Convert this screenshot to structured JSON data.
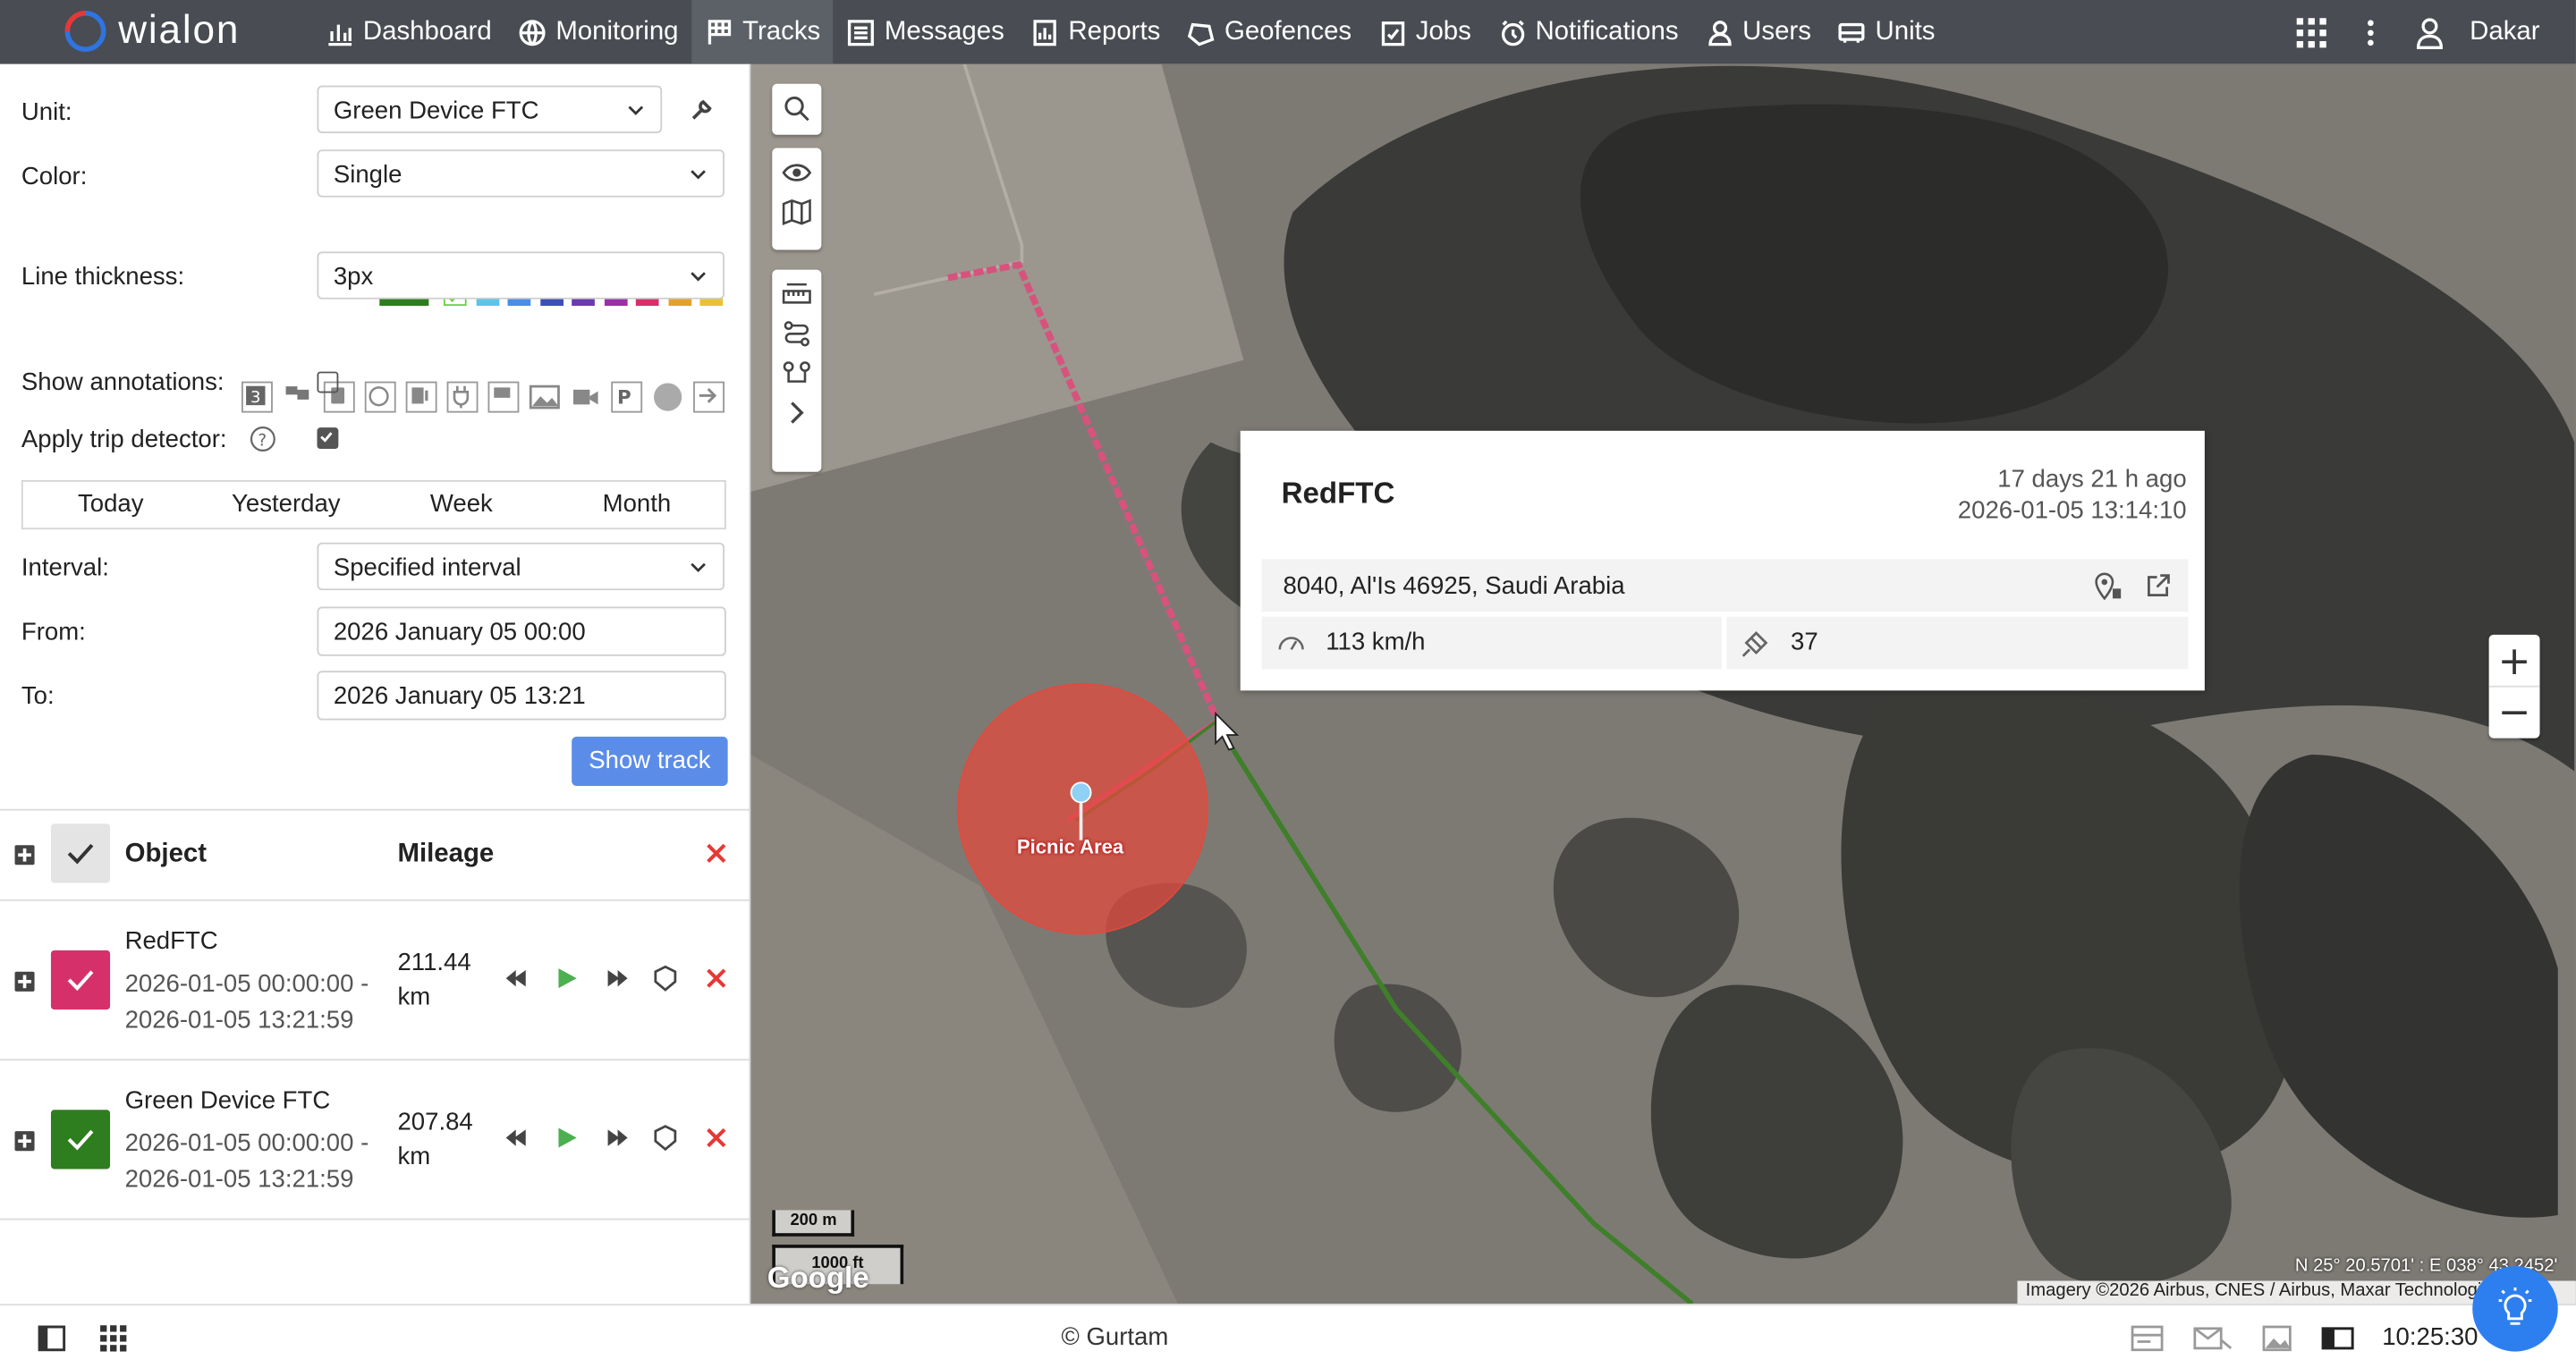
{
  "app": {
    "logo_text": "wialon",
    "user": "Dakar"
  },
  "nav": [
    {
      "label": "Dashboard",
      "icon": "bar-chart-icon"
    },
    {
      "label": "Monitoring",
      "icon": "globe-icon"
    },
    {
      "label": "Tracks",
      "icon": "flag-icon",
      "active": true
    },
    {
      "label": "Messages",
      "icon": "messages-icon"
    },
    {
      "label": "Reports",
      "icon": "reports-icon"
    },
    {
      "label": "Geofences",
      "icon": "geofence-icon"
    },
    {
      "label": "Jobs",
      "icon": "jobs-icon"
    },
    {
      "label": "Notifications",
      "icon": "alarm-icon"
    },
    {
      "label": "Users",
      "icon": "user-icon"
    },
    {
      "label": "Units",
      "icon": "car-icon"
    }
  ],
  "form": {
    "unit_label": "Unit:",
    "unit_value": "Green Device FTC",
    "color_label": "Color:",
    "color_value": "Single",
    "swatches": [
      "#2e7d1e",
      "#6ccf4a",
      "#5bc4e8",
      "#4a8ee8",
      "#3d4fb8",
      "#6a3ab0",
      "#9b2fa8",
      "#d62f6a",
      "#e4a12a",
      "#e8c234"
    ],
    "thickness_label": "Line thickness:",
    "thickness_value": "3px",
    "annotations_label": "Show annotations:",
    "trip_label": "Apply trip detector:",
    "tabs": [
      "Today",
      "Yesterday",
      "Week",
      "Month"
    ],
    "interval_label": "Interval:",
    "interval_value": "Specified interval",
    "from_label": "From:",
    "from_value": "2026 January 05 00:00",
    "to_label": "To:",
    "to_value": "2026 January 05 13:21",
    "show_track": "Show track"
  },
  "table": {
    "header_object": "Object",
    "header_mileage": "Mileage",
    "rows": [
      {
        "name": "RedFTC",
        "from": "2026-01-05 00:00:00 -",
        "to": "2026-01-05 13:21:59",
        "mileage": "211.44",
        "unit": "km",
        "color": "#d6306a"
      },
      {
        "name": "Green Device FTC",
        "from": "2026-01-05 00:00:00 -",
        "to": "2026-01-05 13:21:59",
        "mileage": "207.84",
        "unit": "km",
        "color": "#2e7d1e"
      }
    ]
  },
  "popup": {
    "title": "RedFTC",
    "ago": "17 days 21 h ago",
    "datetime": "2026-01-05 13:14:10",
    "address": "8040, Al'Is 46925, Saudi Arabia",
    "speed": "113 km/h",
    "satellites": "37"
  },
  "map": {
    "geofence_label": "Picnic Area",
    "scale_m": "200 m",
    "scale_ft": "1000 ft",
    "google": "Google",
    "coords": "N 25° 20.5701' : E 038° 43.2452'",
    "attribution": "Imagery ©2026 Airbus, CNES / Airbus, Maxar Technologies"
  },
  "footer": {
    "copyright": "© Gurtam",
    "time": "10:25:30"
  }
}
